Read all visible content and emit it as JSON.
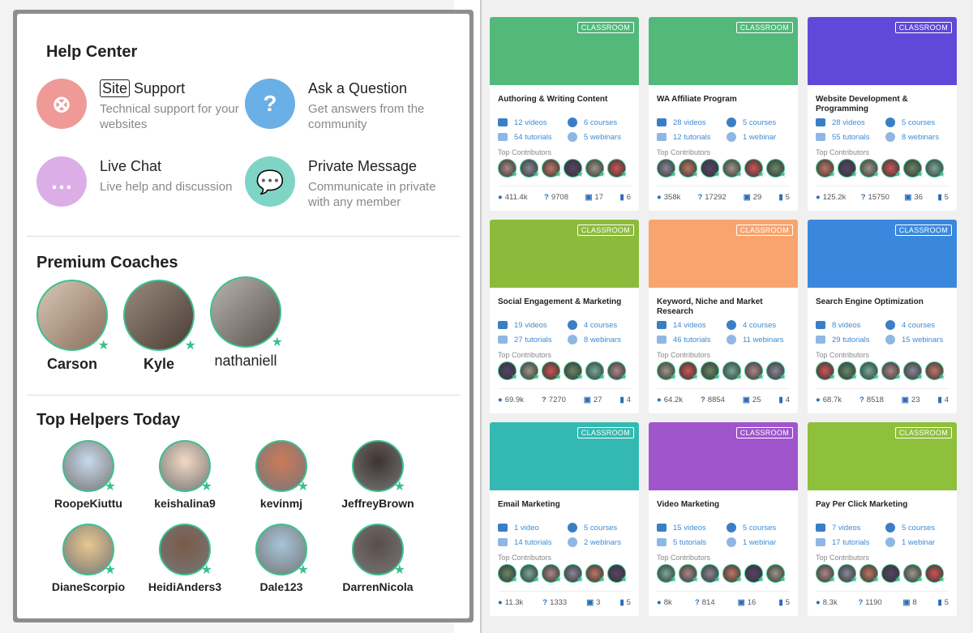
{
  "help": {
    "title": "Help Center",
    "options": [
      {
        "title_badge": "Site",
        "title": "Support",
        "desc": "Technical support for your websites",
        "icon": "lifebuoy-icon",
        "color": "#ef9a96"
      },
      {
        "title": "Ask a Question",
        "desc": "Get answers from the community",
        "icon": "question-icon",
        "color": "#6aafe6"
      },
      {
        "title": "Live Chat",
        "desc": "Live help and discussion",
        "icon": "chat-bubble-icon",
        "color": "#dcaee8"
      },
      {
        "title": "Private Message",
        "desc": "Communicate in private with any member",
        "icon": "messages-icon",
        "color": "#7fd4c6"
      }
    ]
  },
  "coaches": {
    "title": "Premium Coaches",
    "items": [
      "Carson",
      "Kyle",
      "nathaniell"
    ]
  },
  "helpers": {
    "title": "Top Helpers Today",
    "items": [
      "RoopeKiuttu",
      "keishalina9",
      "kevinmj",
      "JeffreyBrown",
      "DianeScorpio",
      "HeidiAnders3",
      "Dale123",
      "DarrenNicola"
    ]
  },
  "classroom_badge": "CLASSROOM",
  "contributors_label": "Top Contributors",
  "cards": [
    {
      "title": "Authoring & Writing Content",
      "color": "#52b97b",
      "videos": "12 videos",
      "courses": "6 courses",
      "tutorials": "54 tutorials",
      "webinars": "5 webinars",
      "stats": [
        "411.4k",
        "9708",
        "17",
        "6"
      ]
    },
    {
      "title": "WA Affiliate Program",
      "color": "#52b97b",
      "videos": "28 videos",
      "courses": "5 courses",
      "tutorials": "12 tutorials",
      "webinars": "1 webinar",
      "stats": [
        "358k",
        "17292",
        "29",
        "5"
      ]
    },
    {
      "title": "Website Development & Programming",
      "color": "#6049d8",
      "videos": "28 videos",
      "courses": "5 courses",
      "tutorials": "55 tutorials",
      "webinars": "8 webinars",
      "stats": [
        "125.2k",
        "15750",
        "36",
        "5"
      ]
    },
    {
      "title": "Social Engagement & Marketing",
      "color": "#8cbb3c",
      "videos": "19 videos",
      "courses": "4 courses",
      "tutorials": "27 tutorials",
      "webinars": "8 webinars",
      "stats": [
        "69.9k",
        "7270",
        "27",
        "4"
      ]
    },
    {
      "title": "Keyword, Niche and Market Research",
      "color": "#f9a46e",
      "videos": "14 videos",
      "courses": "4 courses",
      "tutorials": "46 tutorials",
      "webinars": "11 webinars",
      "stats": [
        "64.2k",
        "8854",
        "25",
        "4"
      ]
    },
    {
      "title": "Search Engine Optimization",
      "color": "#3a88de",
      "videos": "8 videos",
      "courses": "4 courses",
      "tutorials": "29 tutorials",
      "webinars": "15 webinars",
      "stats": [
        "68.7k",
        "8518",
        "23",
        "4"
      ]
    },
    {
      "title": "Email Marketing",
      "color": "#33b9b1",
      "videos": "1 video",
      "courses": "5 courses",
      "tutorials": "14 tutorials",
      "webinars": "2 webinars",
      "stats": [
        "11.3k",
        "1333",
        "3",
        "5"
      ]
    },
    {
      "title": "Video Marketing",
      "color": "#a055cd",
      "videos": "15 videos",
      "courses": "5 courses",
      "tutorials": "5 tutorials",
      "webinars": "1 webinar",
      "stats": [
        "8k",
        "814",
        "16",
        "5"
      ]
    },
    {
      "title": "Pay Per Click Marketing",
      "color": "#8fc03b",
      "videos": "7 videos",
      "courses": "5 courses",
      "tutorials": "17 tutorials",
      "webinars": "1 webinar",
      "stats": [
        "8.3k",
        "1190",
        "8",
        "5"
      ]
    }
  ]
}
